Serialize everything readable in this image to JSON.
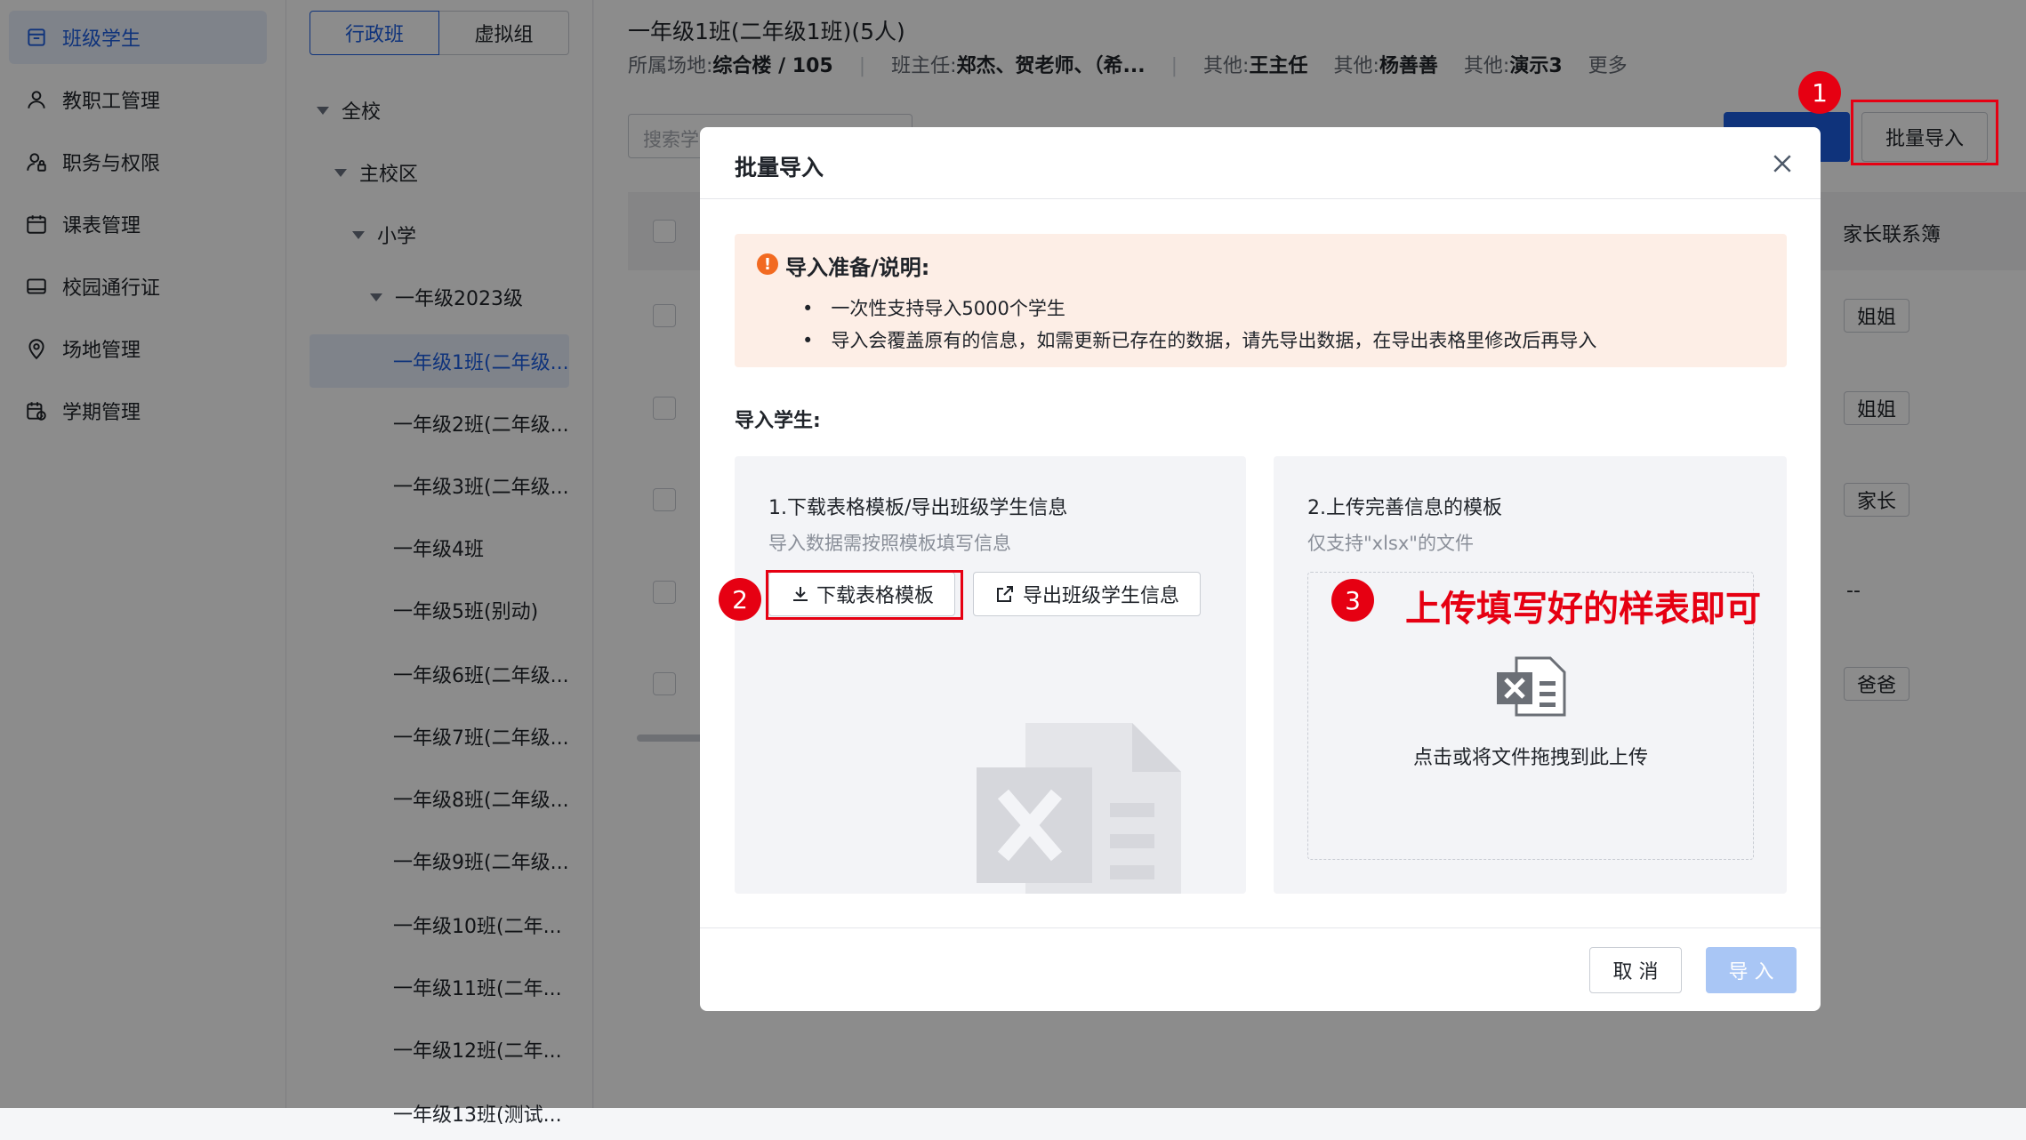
{
  "sidebar": {
    "items": [
      {
        "label": "班级学生",
        "icon": "class-icon",
        "active": true
      },
      {
        "label": "教职工管理",
        "icon": "user-icon"
      },
      {
        "label": "职务与权限",
        "icon": "user-lock-icon"
      },
      {
        "label": "课表管理",
        "icon": "calendar-icon"
      },
      {
        "label": "校园通行证",
        "icon": "card-icon"
      },
      {
        "label": "场地管理",
        "icon": "location-icon"
      },
      {
        "label": "学期管理",
        "icon": "calendar-clock-icon"
      }
    ]
  },
  "tree": {
    "tabs": [
      "行政班",
      "虚拟组"
    ],
    "nodes": [
      {
        "label": "全校"
      },
      {
        "label": "主校区"
      },
      {
        "label": "小学"
      },
      {
        "label": "一年级2023级"
      },
      {
        "label": "一年级1班(二年级..."
      },
      {
        "label": "一年级2班(二年级..."
      },
      {
        "label": "一年级3班(二年级..."
      },
      {
        "label": "一年级4班"
      },
      {
        "label": "一年级5班(别动)"
      },
      {
        "label": "一年级6班(二年级..."
      },
      {
        "label": "一年级7班(二年级..."
      },
      {
        "label": "一年级8班(二年级..."
      },
      {
        "label": "一年级9班(二年级..."
      },
      {
        "label": "一年级10班(二年..."
      },
      {
        "label": "一年级11班(二年..."
      },
      {
        "label": "一年级12班(二年..."
      },
      {
        "label": "一年级13班(测试..."
      }
    ]
  },
  "main": {
    "title": "一年级1班(二年级1班)(5人)",
    "venue_label": "所属场地:",
    "venue_value": "综合楼 / 105",
    "teacher_label": "班主任:",
    "teacher_value": "郑杰、贺老师、（希...",
    "other1_label": "其他:",
    "other1_value": "王主任",
    "other2_label": "其他:",
    "other2_value": "杨善善",
    "other3_label": "其他:",
    "other3_value": "演示3",
    "more": "更多",
    "search_placeholder": "搜索学",
    "batch_import": "批量导入",
    "col_parent": "家长联系簿",
    "parent_tags": [
      "姐姐",
      "姐姐",
      "家长",
      "--",
      "爸爸"
    ]
  },
  "modal": {
    "title": "批量导入",
    "notice_title": "导入准备/说明:",
    "notice_items": [
      "一次性支持导入5000个学生",
      "导入会覆盖原有的信息，如需更新已存在的数据，请先导出数据，在导出表格里修改后再导入"
    ],
    "section_title": "导入学生:",
    "step1_title": "1.下载表格模板/导出班级学生信息",
    "step1_desc": "导入数据需按照模板填写信息",
    "download_btn": "下载表格模板",
    "export_btn": "导出班级学生信息",
    "step2_title": "2.上传完善信息的模板",
    "step2_desc": "仅支持\"xlsx\"的文件",
    "upload_hint": "点击或将文件拖拽到此上传",
    "cancel": "取 消",
    "confirm": "导 入"
  },
  "annotations": {
    "badge1": "1",
    "badge2": "2",
    "badge3": "3",
    "callout": "上传填写好的样表即可"
  },
  "colors": {
    "primary": "#1d5ee0",
    "annotation_red": "#e60012",
    "notice_bg": "#fdeee6",
    "notice_icon": "#f26a21"
  }
}
